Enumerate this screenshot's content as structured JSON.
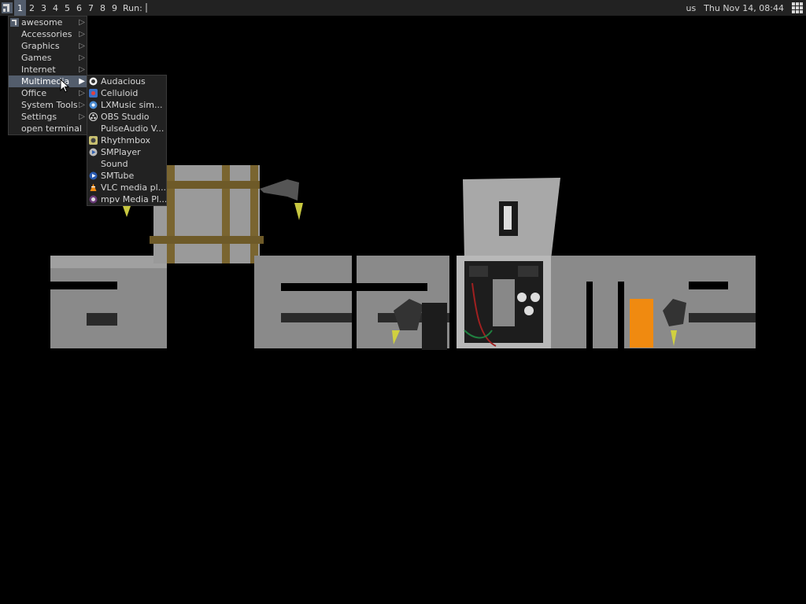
{
  "topbar": {
    "tags": [
      "1",
      "2",
      "3",
      "4",
      "5",
      "6",
      "7",
      "8",
      "9"
    ],
    "active_tag": "1",
    "run_label": "Run:",
    "keyboard_layout": "us",
    "clock": "Thu Nov 14, 08:44"
  },
  "main_menu": {
    "items": [
      {
        "label": "awesome",
        "icon": "awesome-icon",
        "submenu": true
      },
      {
        "label": "Accessories",
        "submenu": true
      },
      {
        "label": "Graphics",
        "submenu": true
      },
      {
        "label": "Games",
        "submenu": true
      },
      {
        "label": "Internet",
        "submenu": true
      },
      {
        "label": "Multimedia",
        "submenu": true,
        "selected": true
      },
      {
        "label": "Office",
        "submenu": true
      },
      {
        "label": "System Tools",
        "submenu": true
      },
      {
        "label": "Settings",
        "submenu": true
      },
      {
        "label": "open terminal",
        "submenu": false
      }
    ]
  },
  "multimedia_menu": {
    "items": [
      {
        "label": "Audacious",
        "icon": "audacious-icon"
      },
      {
        "label": "Celluloid",
        "icon": "celluloid-icon"
      },
      {
        "label": "LXMusic sim...",
        "icon": "lxmusic-icon"
      },
      {
        "label": "OBS Studio",
        "icon": "obs-icon"
      },
      {
        "label": "PulseAudio V...",
        "icon": ""
      },
      {
        "label": "Rhythmbox",
        "icon": "rhythmbox-icon"
      },
      {
        "label": "SMPlayer",
        "icon": "smplayer-icon"
      },
      {
        "label": "Sound",
        "icon": ""
      },
      {
        "label": "SMTube",
        "icon": "smtube-icon"
      },
      {
        "label": "VLC media pl...",
        "icon": "vlc-icon"
      },
      {
        "label": "mpv Media Pl...",
        "icon": "mpv-icon"
      }
    ]
  },
  "colors": {
    "bar_bg": "#222222",
    "focus_bg": "#535d6c",
    "text": "#d6d6d6"
  }
}
